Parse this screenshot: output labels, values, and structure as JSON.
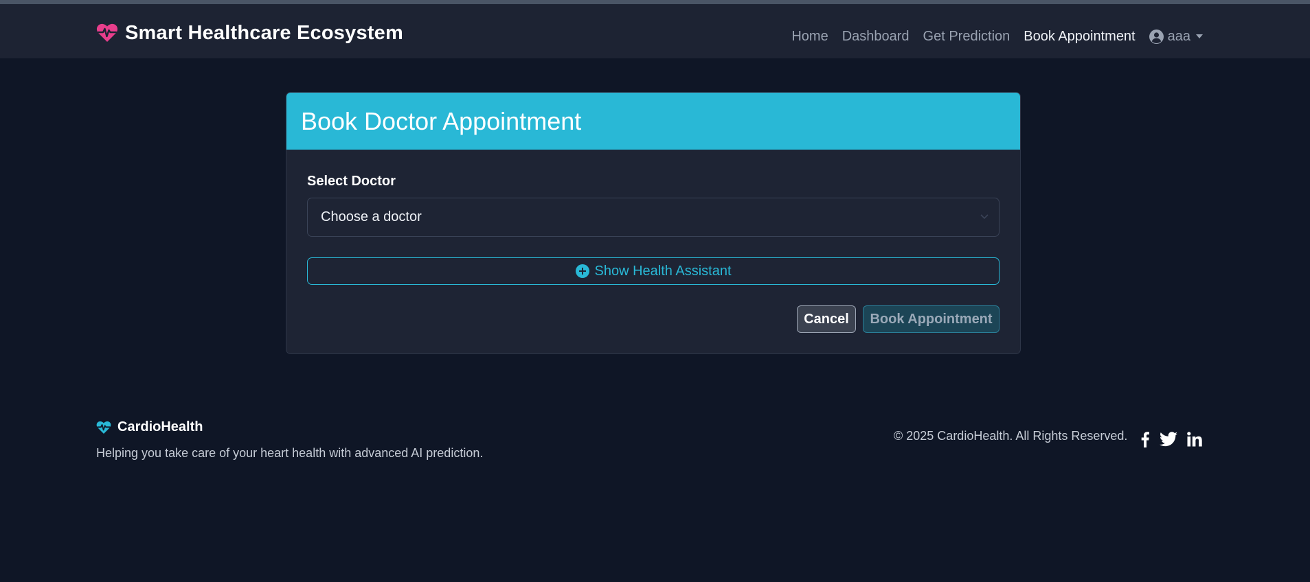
{
  "navbar": {
    "brand": "Smart Healthcare Ecosystem",
    "brand_icon": "heart-pulse-icon",
    "links": [
      "Home",
      "Dashboard",
      "Get Prediction",
      "Book Appointment"
    ],
    "active_link": "Book Appointment",
    "user": "aaa",
    "user_icon": "user-circle-icon"
  },
  "card": {
    "title": "Book Doctor Appointment",
    "doctor_label": "Select Doctor",
    "doctor_select_value": "Choose a doctor",
    "assistant_button": "Show Health Assistant",
    "assistant_icon": "plus-circle-icon",
    "cancel_button": "Cancel",
    "book_button": "Book Appointment"
  },
  "footer": {
    "brand": "CardioHealth",
    "tagline": "Helping you take care of your heart health with advanced AI prediction.",
    "copyright": "© 2025 CardioHealth. All Rights Reserved.",
    "social_icons": [
      "facebook-icon",
      "twitter-icon",
      "linkedin-icon"
    ]
  },
  "colors": {
    "background": "#0f1626",
    "navbar": "#1d2333",
    "card": "#1e2434",
    "accent": "#29b8d6",
    "brand_heart": "#e83e8c"
  }
}
